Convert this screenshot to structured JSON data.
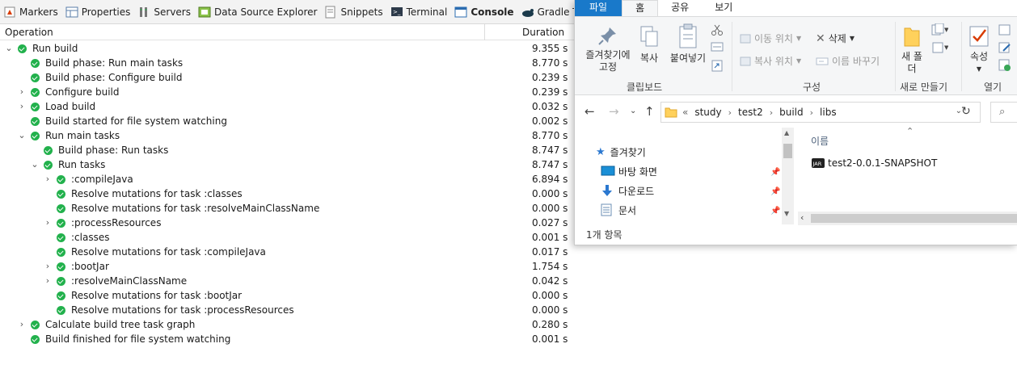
{
  "eclipse": {
    "tabs": [
      {
        "label": "Markers"
      },
      {
        "label": "Properties"
      },
      {
        "label": "Servers"
      },
      {
        "label": "Data Source Explorer"
      },
      {
        "label": "Snippets"
      },
      {
        "label": "Terminal"
      },
      {
        "label": "Console"
      },
      {
        "label": "Gradle Tasks"
      }
    ],
    "columns": {
      "operation": "Operation",
      "duration": "Duration"
    },
    "rows": [
      {
        "label": "Run build",
        "duration": "9.355 s",
        "level": 0,
        "twisty": "open"
      },
      {
        "label": "Build phase: Run main tasks",
        "duration": "8.770 s",
        "level": 1,
        "twisty": "none"
      },
      {
        "label": "Build phase: Configure build",
        "duration": "0.239 s",
        "level": 1,
        "twisty": "none"
      },
      {
        "label": "Configure build",
        "duration": "0.239 s",
        "level": 1,
        "twisty": "closed"
      },
      {
        "label": "Load build",
        "duration": "0.032 s",
        "level": 1,
        "twisty": "closed"
      },
      {
        "label": "Build started for file system watching",
        "duration": "0.002 s",
        "level": 1,
        "twisty": "none"
      },
      {
        "label": "Run main tasks",
        "duration": "8.770 s",
        "level": 1,
        "twisty": "open"
      },
      {
        "label": "Build phase: Run tasks",
        "duration": "8.747 s",
        "level": 2,
        "twisty": "none"
      },
      {
        "label": "Run tasks",
        "duration": "8.747 s",
        "level": 2,
        "twisty": "open"
      },
      {
        "label": ":compileJava",
        "duration": "6.894 s",
        "level": 3,
        "twisty": "closed"
      },
      {
        "label": "Resolve mutations for task :classes",
        "duration": "0.000 s",
        "level": 3,
        "twisty": "none"
      },
      {
        "label": "Resolve mutations for task :resolveMainClassName",
        "duration": "0.000 s",
        "level": 3,
        "twisty": "none"
      },
      {
        "label": ":processResources",
        "duration": "0.027 s",
        "level": 3,
        "twisty": "closed"
      },
      {
        "label": ":classes",
        "duration": "0.001 s",
        "level": 3,
        "twisty": "none"
      },
      {
        "label": "Resolve mutations for task :compileJava",
        "duration": "0.017 s",
        "level": 3,
        "twisty": "none"
      },
      {
        "label": ":bootJar",
        "duration": "1.754 s",
        "level": 3,
        "twisty": "closed"
      },
      {
        "label": ":resolveMainClassName",
        "duration": "0.042 s",
        "level": 3,
        "twisty": "closed"
      },
      {
        "label": "Resolve mutations for task :bootJar",
        "duration": "0.000 s",
        "level": 3,
        "twisty": "none"
      },
      {
        "label": "Resolve mutations for task :processResources",
        "duration": "0.000 s",
        "level": 3,
        "twisty": "none"
      },
      {
        "label": "Calculate build tree task graph",
        "duration": "0.280 s",
        "level": 1,
        "twisty": "closed"
      },
      {
        "label": "Build finished for file system watching",
        "duration": "0.001 s",
        "level": 1,
        "twisty": "none"
      }
    ]
  },
  "explorer": {
    "ribbon_tabs": [
      "파일",
      "홈",
      "공유",
      "보기"
    ],
    "clipboard": {
      "pin_label": "즐겨찾기에 고정",
      "copy_label": "복사",
      "paste_label": "붙여넣기",
      "group": "클립보드"
    },
    "organize": {
      "move_to": "이동 위치",
      "copy_to": "복사 위치",
      "delete": "삭제",
      "rename": "이름 바꾸기",
      "group": "구성"
    },
    "new": {
      "new_folder": "새 폴더",
      "group": "새로 만들기"
    },
    "open": {
      "properties": "속성",
      "group": "열기"
    },
    "breadcrumb": [
      "study",
      "test2",
      "build",
      "libs"
    ],
    "breadcrumb_prefix": "«",
    "nav_items": [
      "즐겨찾기",
      "바탕 화면",
      "다운로드",
      "문서"
    ],
    "column_name": "이름",
    "files": [
      "test2-0.0.1-SNAPSHOT"
    ],
    "status": "1개 항목"
  },
  "colors": {
    "success": "#22b14c",
    "file_tab": "#1979ca",
    "folder": "#ffd15c"
  }
}
